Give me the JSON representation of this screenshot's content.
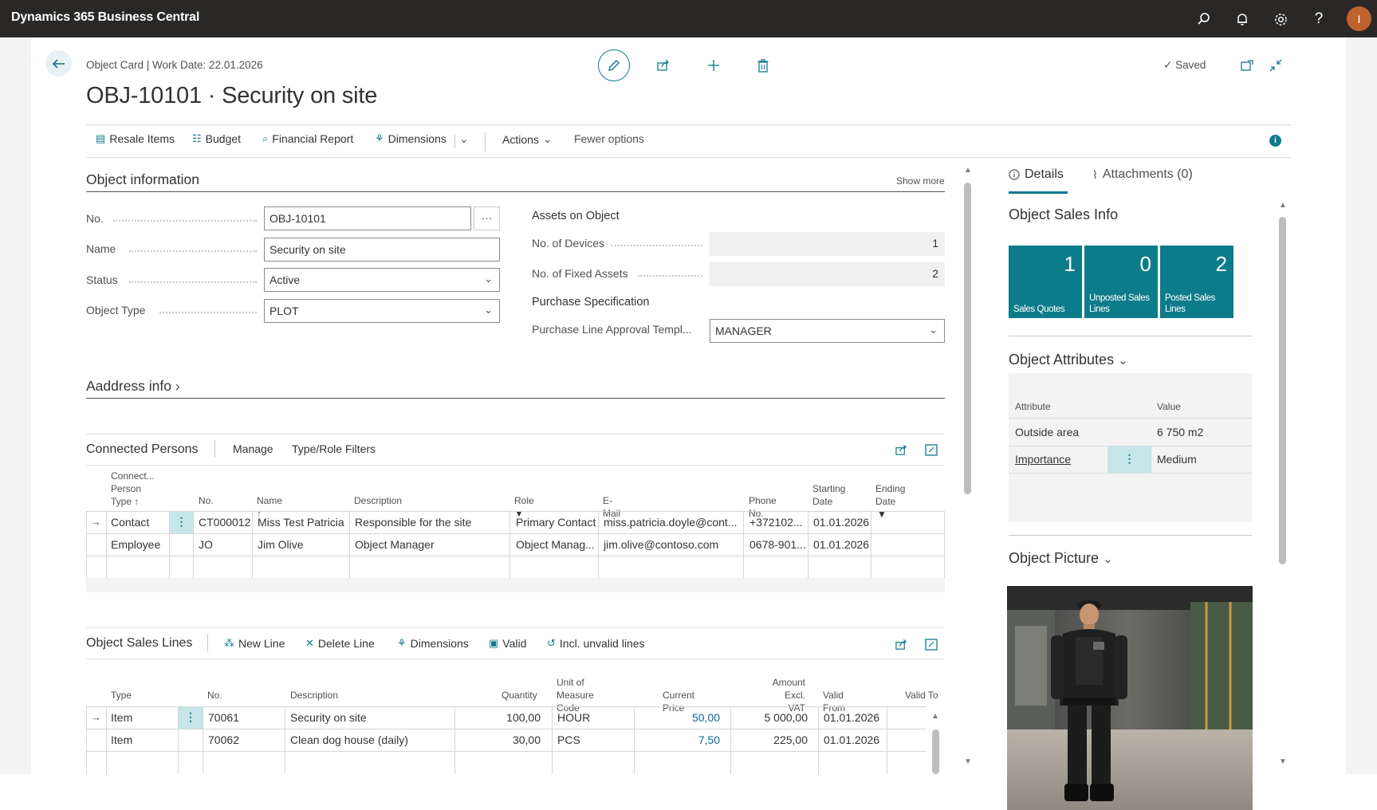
{
  "app": {
    "title": "Dynamics 365 Business Central",
    "avatar_initial": "I"
  },
  "header": {
    "breadcrumb": "Object Card | Work Date: 22.01.2026",
    "title": "OBJ-10101 · Security on site",
    "saved_label": "Saved"
  },
  "actions": {
    "resale_items": "Resale Items",
    "budget": "Budget",
    "financial_report": "Financial Report",
    "dimensions": "Dimensions",
    "actions": "Actions",
    "fewer_options": "Fewer options"
  },
  "object_information": {
    "title": "Object information",
    "show_more": "Show more",
    "fields": {
      "no_label": "No.",
      "no_value": "OBJ-10101",
      "name_label": "Name",
      "name_value": "Security on site",
      "status_label": "Status",
      "status_value": "Active",
      "type_label": "Object Type",
      "type_value": "PLOT"
    },
    "assets": {
      "title": "Assets on Object",
      "devices_label": "No. of Devices",
      "devices_value": "1",
      "fixed_assets_label": "No. of Fixed Assets",
      "fixed_assets_value": "2"
    },
    "purchase": {
      "title": "Purchase Specification",
      "template_label": "Purchase Line Approval Templ...",
      "template_value": "MANAGER"
    }
  },
  "address_info": {
    "title": "Aaddress info"
  },
  "connected_persons": {
    "title": "Connected Persons",
    "manage": "Manage",
    "filters": "Type/Role Filters",
    "headers": {
      "type_l1": "Connect...",
      "type_l2": "Person",
      "type_l3": "Type ↑",
      "no": "No.",
      "name": "Name ↑",
      "description": "Description",
      "role": "Role",
      "email": "E-Mail",
      "phone": "Phone No.",
      "start_l1": "Starting",
      "start_l2": "Date",
      "ending": "Ending Date"
    },
    "rows": [
      {
        "type": "Contact",
        "no": "CT000012",
        "name": "Miss Test Patricia",
        "description": "Responsible for the site",
        "role": "Primary Contact",
        "email": "miss.patricia.doyle@cont...",
        "phone": "+372102...",
        "start": "01.01.2026",
        "end": ""
      },
      {
        "type": "Employee",
        "no": "JO",
        "name": "Jim Olive",
        "description": "Object Manager",
        "role": "Object Manag...",
        "email": "jim.olive@contoso.com",
        "phone": "0678-901...",
        "start": "01.01.2026",
        "end": ""
      }
    ]
  },
  "sales_lines": {
    "title": "Object Sales Lines",
    "new_line": "New Line",
    "delete_line": "Delete Line",
    "dimensions": "Dimensions",
    "valid": "Valid",
    "incl_invalid": "Incl. unvalid lines",
    "headers": {
      "type": "Type",
      "no": "No.",
      "description": "Description",
      "quantity": "Quantity",
      "uom_l1": "Unit of",
      "uom_l2": "Measure Code",
      "price": "Current Price",
      "amount_l1": "Amount Excl.",
      "amount_l2": "VAT",
      "valid_from": "Valid From",
      "valid_to": "Valid To"
    },
    "rows": [
      {
        "type": "Item",
        "no": "70061",
        "description": "Security on site",
        "quantity": "100,00",
        "uom": "HOUR",
        "price": "50,00",
        "amount": "5 000,00",
        "valid_from": "01.01.2026"
      },
      {
        "type": "Item",
        "no": "70062",
        "description": "Clean dog house (daily)",
        "quantity": "30,00",
        "uom": "PCS",
        "price": "7,50",
        "amount": "225,00",
        "valid_from": "01.01.2026"
      }
    ]
  },
  "factbox": {
    "tab_details": "Details",
    "tab_attachments": "Attachments (0)",
    "sales_info_title": "Object Sales Info",
    "tiles": [
      {
        "value": "1",
        "label_l1": "Sales Quotes",
        "label_l2": ""
      },
      {
        "value": "0",
        "label_l1": "Unposted Sales",
        "label_l2": "Lines"
      },
      {
        "value": "2",
        "label_l1": "Posted Sales",
        "label_l2": "Lines"
      }
    ],
    "attributes_title": "Object Attributes",
    "attr_head_attribute": "Attribute",
    "attr_head_value": "Value",
    "attributes": [
      {
        "attribute": "Outside area",
        "value": "6 750 m2"
      },
      {
        "attribute": "Importance",
        "value": "Medium"
      }
    ],
    "picture_title": "Object Picture"
  },
  "colors": {
    "accent": "#0f7b8c",
    "topbar": "#292827",
    "tile": "#0d7c8a"
  }
}
